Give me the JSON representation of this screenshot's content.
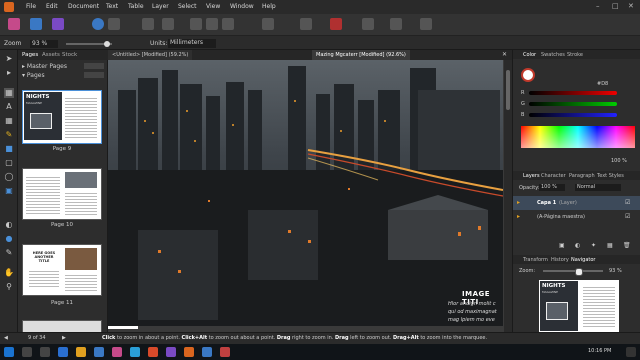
{
  "menubar": {
    "items": [
      "File",
      "Edit",
      "Document",
      "Text",
      "Table",
      "Layer",
      "Select",
      "View",
      "Window",
      "Help"
    ]
  },
  "context": {
    "zoom_label": "Zoom",
    "zoom_value": "93 %",
    "units_label": "Units:",
    "units_value": "Millimeters"
  },
  "pages_panel": {
    "tabs": [
      "Pages",
      "Assets",
      "Stock"
    ],
    "master_pages": "Master Pages",
    "pages": "Pages",
    "thumbs": [
      {
        "label": "Page 9",
        "title": "NIGHTS",
        "subtitle": "MAGAZINE"
      },
      {
        "label": "Page 10"
      },
      {
        "label": "Page 11",
        "title": "HERE GOES\nANOTHER\nTITLE"
      }
    ]
  },
  "doc_tabs": [
    "<Untitled> [Modified] (59.2%)",
    "Mazing Mgcaterr [Modified] (92.6%)"
  ],
  "canvas": {
    "overlay_title": "IMAGE TITI",
    "overlay_lines": [
      "Hlor andign molit c",
      "qui od maximagnat",
      "mag lpiem mo eve"
    ]
  },
  "right_panel": {
    "color_tabs": [
      "Color",
      "Swatches",
      "Stroke"
    ],
    "hex_value": "#D8",
    "rgb_labels": [
      "R",
      "G",
      "B"
    ],
    "opacity_value": "100 %",
    "layers_tabs": [
      "Layers",
      "Character",
      "Paragraph",
      "Text Styles"
    ],
    "opacity_label": "Opacity:",
    "opacity_pct": "100 %",
    "blend_mode": "Normal",
    "layer_rows": [
      {
        "name": "Capa 1",
        "type": "(Layer)"
      },
      {
        "name": "(A-Página maestra)",
        "type": ""
      }
    ],
    "nav_tabs": [
      "Transform",
      "History",
      "Navigator"
    ],
    "zoom_label": "Zoom:",
    "zoom_value": "93 %",
    "preview_title": "NIGHTS",
    "preview_sub": "MAGAZINE"
  },
  "status": {
    "page_info": "9 of 34",
    "hint_parts": [
      {
        "t": "Click",
        "b": true
      },
      {
        "t": " to zoom in about a point. ",
        "b": false
      },
      {
        "t": "Click+Alt",
        "b": true
      },
      {
        "t": " to zoom out about a point. ",
        "b": false
      },
      {
        "t": "Drag",
        "b": true
      },
      {
        "t": " right to zoom in. ",
        "b": false
      },
      {
        "t": "Drag",
        "b": true
      },
      {
        "t": " left to zoom out. ",
        "b": false
      },
      {
        "t": "Drag+Alt",
        "b": true
      },
      {
        "t": " to zoom into the marquee.",
        "b": false
      }
    ]
  },
  "taskbar": {
    "time": "10:16 PM"
  },
  "colors": {
    "accent": "#4a90d9",
    "affinity_blue": "#3a78c4",
    "affinity_orange": "#d9651f"
  }
}
